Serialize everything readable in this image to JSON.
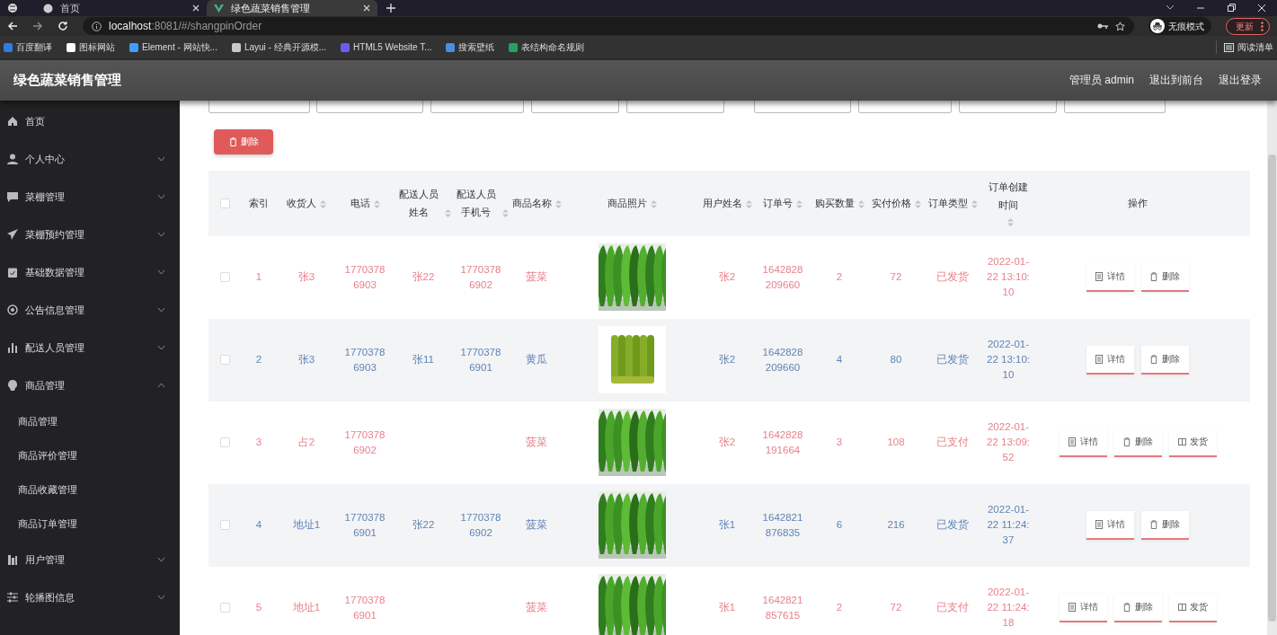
{
  "browser": {
    "tabs": [
      {
        "title": "首页",
        "selected": false
      },
      {
        "title": "绿色蔬菜销售管理",
        "selected": true
      }
    ],
    "url_host": "localhost",
    "url_path": ":8081/#/shangpinOrder",
    "profile_label": "无痕模式",
    "update_button": "更新",
    "bookmarks": [
      {
        "label": "百度翻译",
        "color": "#2f7de1"
      },
      {
        "label": "图标网站",
        "color": "#ffffff"
      },
      {
        "label": "Element - 网站快...",
        "color": "#409eff"
      },
      {
        "label": "Layui - 经典开源模...",
        "color": "#c9c9c9"
      },
      {
        "label": "HTML5 Website T...",
        "color": "#6a5cf0"
      },
      {
        "label": "搜索壁纸",
        "color": "#4b8fe0"
      },
      {
        "label": "表结构命名规则",
        "color": "#21a366"
      }
    ],
    "reading_list": "阅读清单"
  },
  "app": {
    "title": "绿色蔬菜销售管理",
    "header_links": [
      "管理员 admin",
      "退出到前台",
      "退出登录"
    ]
  },
  "sidebar": {
    "items": [
      {
        "label": "首页",
        "kind": "link"
      },
      {
        "label": "个人中心",
        "kind": "menu",
        "expanded": false
      },
      {
        "label": "菜棚管理",
        "kind": "menu",
        "expanded": false
      },
      {
        "label": "菜棚预约管理",
        "kind": "menu",
        "expanded": false
      },
      {
        "label": "基础数据管理",
        "kind": "menu",
        "expanded": false
      },
      {
        "label": "公告信息管理",
        "kind": "menu",
        "expanded": false
      },
      {
        "label": "配送人员管理",
        "kind": "menu",
        "expanded": false
      },
      {
        "label": "商品管理",
        "kind": "menu",
        "expanded": true,
        "children": [
          {
            "label": "商品管理"
          },
          {
            "label": "商品评价管理"
          },
          {
            "label": "商品收藏管理"
          },
          {
            "label": "商品订单管理"
          }
        ]
      },
      {
        "label": "用户管理",
        "kind": "menu",
        "expanded": false
      },
      {
        "label": "轮播图信息",
        "kind": "menu",
        "expanded": false
      }
    ]
  },
  "delete_button": "删除",
  "table": {
    "header_checked": false,
    "columns": [
      {
        "label": "索引",
        "sortable": false
      },
      {
        "label": "收货人",
        "sortable": true
      },
      {
        "label": "电话",
        "sortable": true
      },
      {
        "label": "配送人员姓名",
        "sortable": true
      },
      {
        "label": "配送人员手机号",
        "sortable": true
      },
      {
        "label": "商品名称",
        "sortable": true
      },
      {
        "label": "商品照片",
        "sortable": true
      },
      {
        "label": "用户姓名",
        "sortable": true
      },
      {
        "label": "订单号",
        "sortable": true
      },
      {
        "label": "购买数量",
        "sortable": true
      },
      {
        "label": "实付价格",
        "sortable": true
      },
      {
        "label": "订单类型",
        "sortable": true
      },
      {
        "label": "订单创建时间",
        "sortable": true
      },
      {
        "label": "操作",
        "sortable": false
      }
    ],
    "rows": [
      {
        "checked": false,
        "cells": [
          "1",
          "张3",
          "17703786903",
          "张22",
          "17703786902",
          "菠菜",
          "",
          "张2",
          "1642828209660",
          "2",
          "72",
          "已发货",
          "2022-01-22 13:10:10"
        ],
        "actions": [
          "详情",
          "删除"
        ]
      },
      {
        "checked": false,
        "cells": [
          "2",
          "张3",
          "17703786903",
          "张11",
          "17703786901",
          "黄瓜",
          "",
          "张2",
          "1642828209660",
          "4",
          "80",
          "已发货",
          "2022-01-22 13:10:10"
        ],
        "actions": [
          "详情",
          "删除"
        ]
      },
      {
        "checked": false,
        "cells": [
          "3",
          "占2",
          "17703786902",
          "",
          "",
          "菠菜",
          "",
          "张2",
          "1642828191664",
          "3",
          "108",
          "已支付",
          "2022-01-22 13:09:52"
        ],
        "actions": [
          "详情",
          "删除",
          "发货"
        ]
      },
      {
        "checked": false,
        "cells": [
          "4",
          "地址1",
          "17703786901",
          "张22",
          "17703786902",
          "菠菜",
          "",
          "张1",
          "1642821876835",
          "6",
          "216",
          "已发货",
          "2022-01-22 11:24:37"
        ],
        "actions": [
          "详情",
          "删除"
        ]
      },
      {
        "checked": false,
        "cells": [
          "5",
          "地址1",
          "17703786901",
          "",
          "",
          "菠菜",
          "",
          "张1",
          "1642821857615",
          "2",
          "72",
          "已支付",
          "2022-01-22 11:24:18"
        ],
        "actions": [
          "详情",
          "删除",
          "发货"
        ]
      }
    ]
  }
}
